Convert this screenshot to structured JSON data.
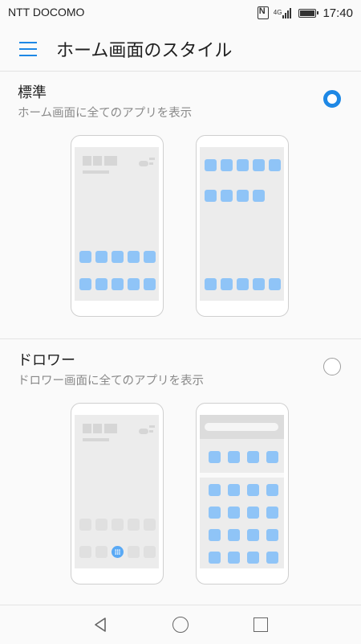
{
  "status_bar": {
    "carrier": "NTT DOCOMO",
    "network": "4G",
    "time": "17:40",
    "icons": [
      "nfc-icon",
      "signal-icon",
      "battery-icon"
    ]
  },
  "header": {
    "title": "ホーム画面のスタイル",
    "menu_icon": "menu-icon",
    "accent_color": "#1e88e5"
  },
  "options": [
    {
      "title": "標準",
      "description": "ホーム画面に全てのアプリを表示",
      "selected": true
    },
    {
      "title": "ドロワー",
      "description": "ドロワー画面に全てのアプリを表示",
      "selected": false
    }
  ],
  "nav_bar": {
    "icons": [
      "back-icon",
      "home-icon",
      "recent-apps-icon"
    ]
  }
}
